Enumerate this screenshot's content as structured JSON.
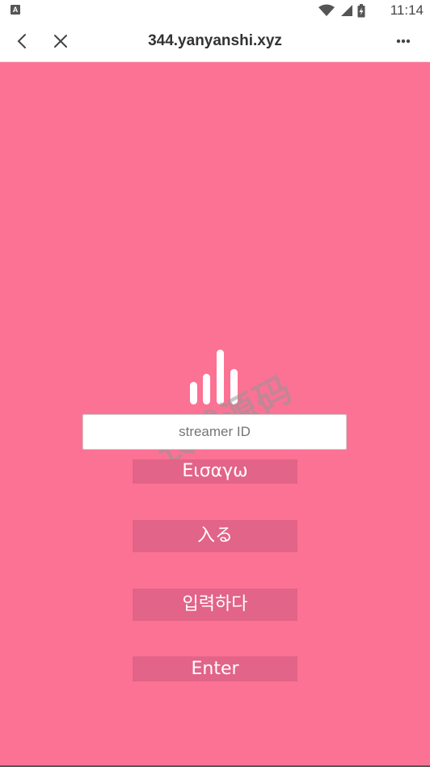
{
  "status_bar": {
    "app_badge": "A",
    "time": "11:14"
  },
  "nav": {
    "title": "344.yanyanshi.xyz"
  },
  "watermark": {
    "text": "长城源码"
  },
  "form": {
    "streamer_placeholder": "streamer ID",
    "streamer_value": ""
  },
  "buttons": {
    "greek": "Εισαγω",
    "japanese": "入る",
    "korean": "입력하다",
    "english": "Enter"
  },
  "colors": {
    "page_background": "#fc7294",
    "button_background": "#e26488"
  }
}
